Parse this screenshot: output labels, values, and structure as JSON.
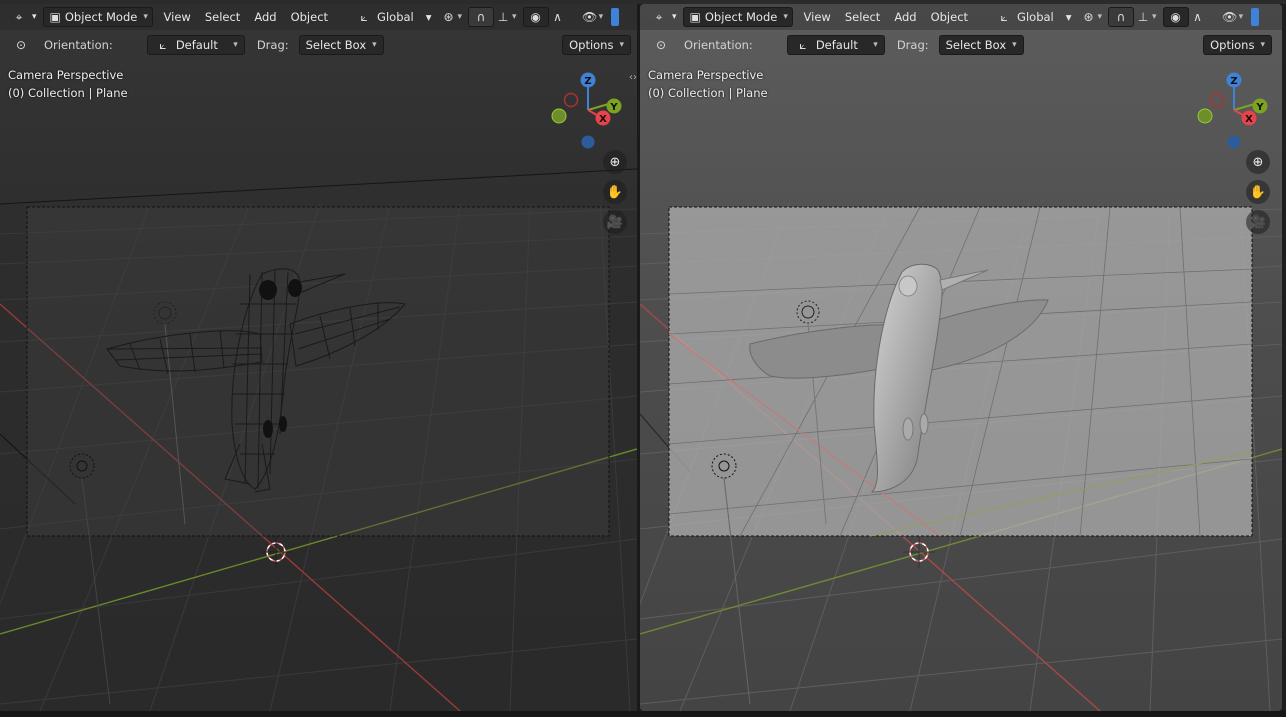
{
  "left_viewport": {
    "mode_label": "Object Mode",
    "menus": [
      "View",
      "Select",
      "Add",
      "Object"
    ],
    "transform_orientation": "Global",
    "orientation_label": "Orientation:",
    "orientation_value": "Default",
    "drag_label": "Drag:",
    "drag_value": "Select Box",
    "options_label": "Options",
    "overlay_line1": "Camera Perspective",
    "overlay_line2": "(0) Collection | Plane",
    "shading": "wireframe"
  },
  "right_viewport": {
    "mode_label": "Object Mode",
    "menus": [
      "View",
      "Select",
      "Add",
      "Object"
    ],
    "transform_orientation": "Global",
    "orientation_label": "Orientation:",
    "orientation_value": "Default",
    "drag_label": "Drag:",
    "drag_value": "Select Box",
    "options_label": "Options",
    "overlay_line1": "Camera Perspective",
    "overlay_line2": "(0) Collection | Plane",
    "shading": "solid"
  },
  "gizmo_axes": {
    "z": "Z",
    "y": "Y",
    "x": "X"
  },
  "colors": {
    "x_axis": "#e8434a",
    "y_axis": "#7da320",
    "z_axis": "#3f82d6"
  },
  "icons": {
    "editor_type": "viewport-icon",
    "mode": "object-mode-icon",
    "transform": "transform-pivot-icon",
    "snap": "magnet-icon",
    "visibility": "eye-icon",
    "zoom": "zoom-icon",
    "pan": "hand-icon",
    "camera": "camera-icon"
  }
}
